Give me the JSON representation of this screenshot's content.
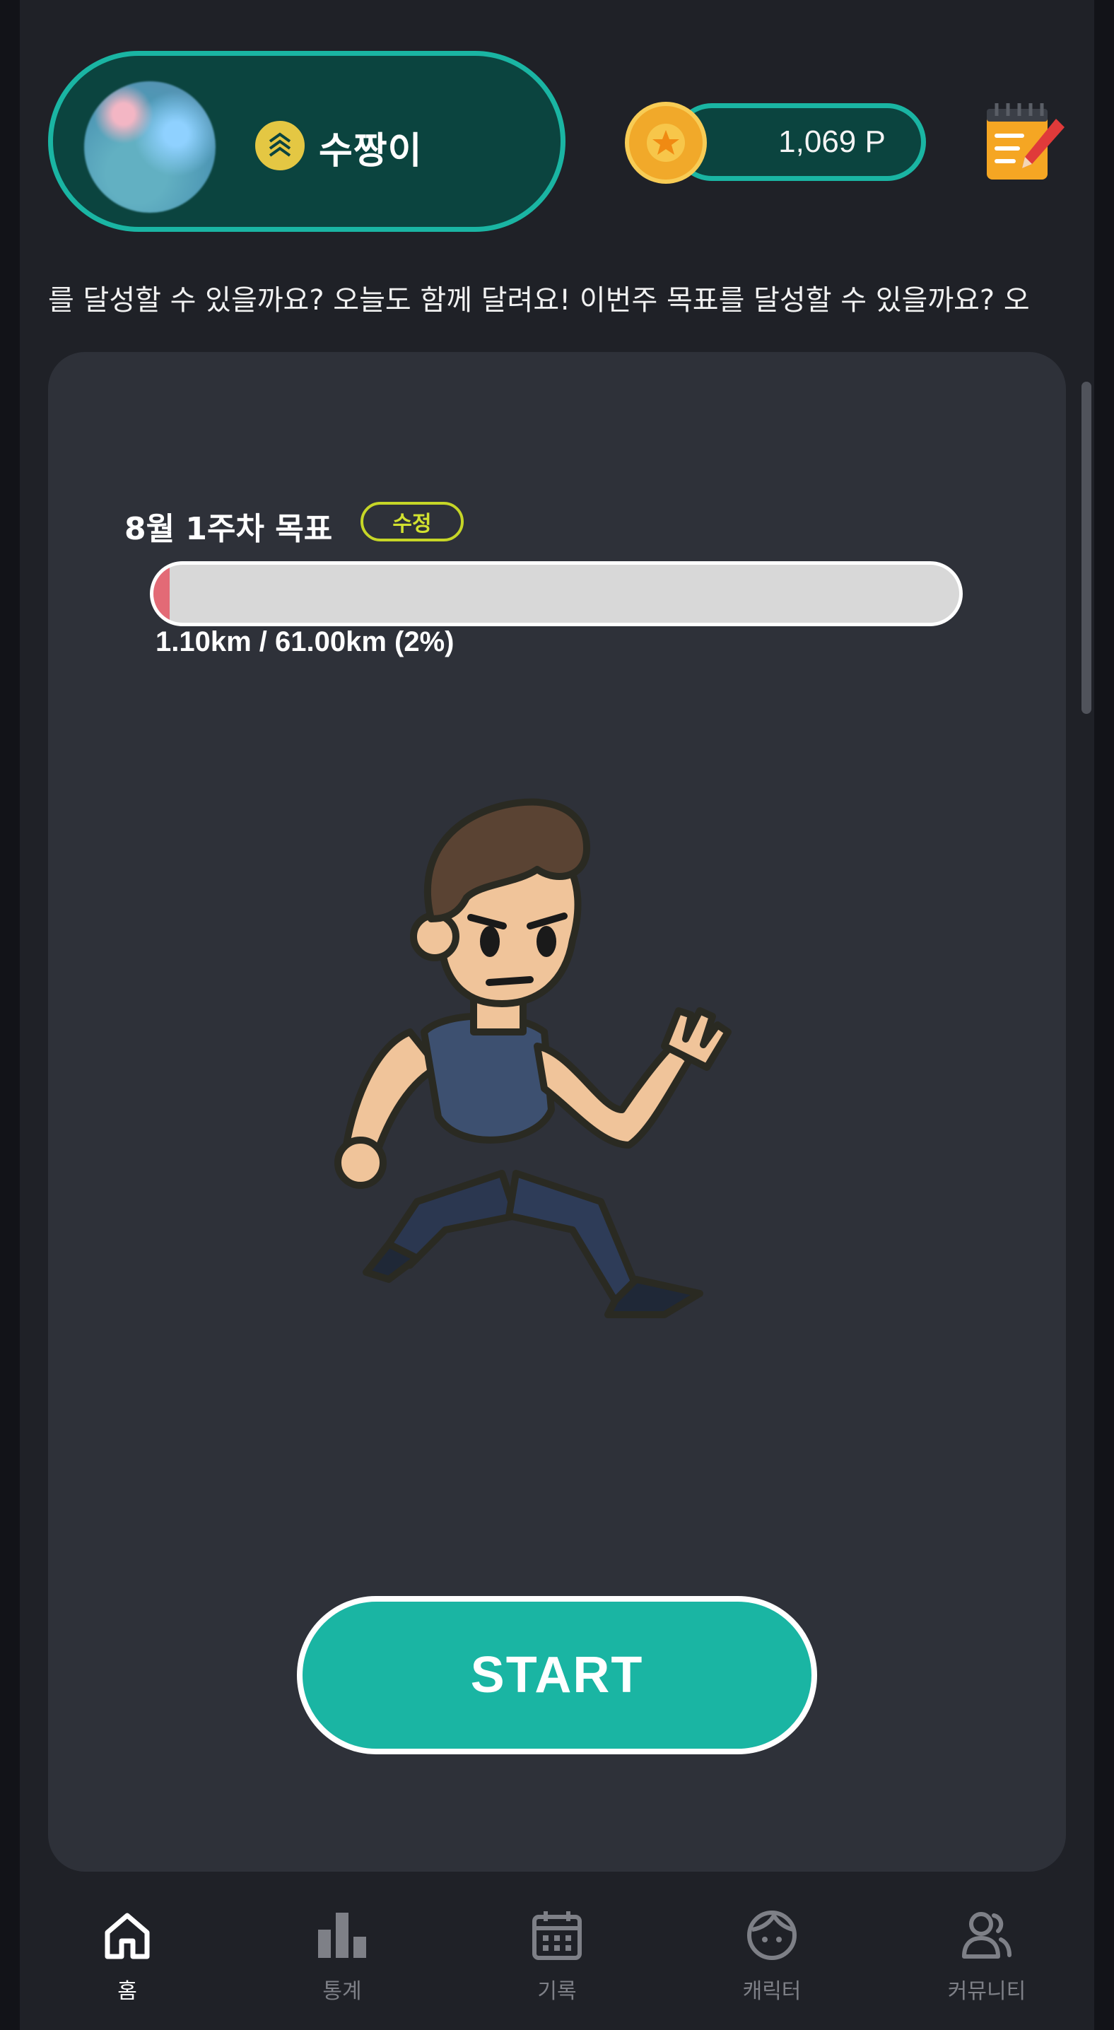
{
  "header": {
    "nickname": "수짱이",
    "points": "1,069 P"
  },
  "marquee_text": "를 달성할 수 있을까요? 오늘도 함께 달려요!  이번주 목표를 달성할 수 있을까요? 오",
  "goal": {
    "title": "8월 1주차 목표",
    "edit_label": "수정",
    "progress_text": "1.10km / 61.00km (2%)",
    "progress_fraction": 0.02
  },
  "start_label": "START",
  "nav": {
    "items": [
      {
        "label": "홈",
        "icon": "home-icon",
        "active": true
      },
      {
        "label": "통계",
        "icon": "chart-bars-icon",
        "active": false
      },
      {
        "label": "기록",
        "icon": "calendar-icon",
        "active": false
      },
      {
        "label": "캐릭터",
        "icon": "character-face-icon",
        "active": false
      },
      {
        "label": "커뮤니티",
        "icon": "community-icon",
        "active": false
      }
    ]
  },
  "colors": {
    "accent": "#1ab5a3",
    "pill_bg": "#0b443f",
    "card_bg": "#2e3139",
    "progress_fill": "#e36a76",
    "edit_chip": "#c6d627",
    "coin": "#f1a92a"
  }
}
